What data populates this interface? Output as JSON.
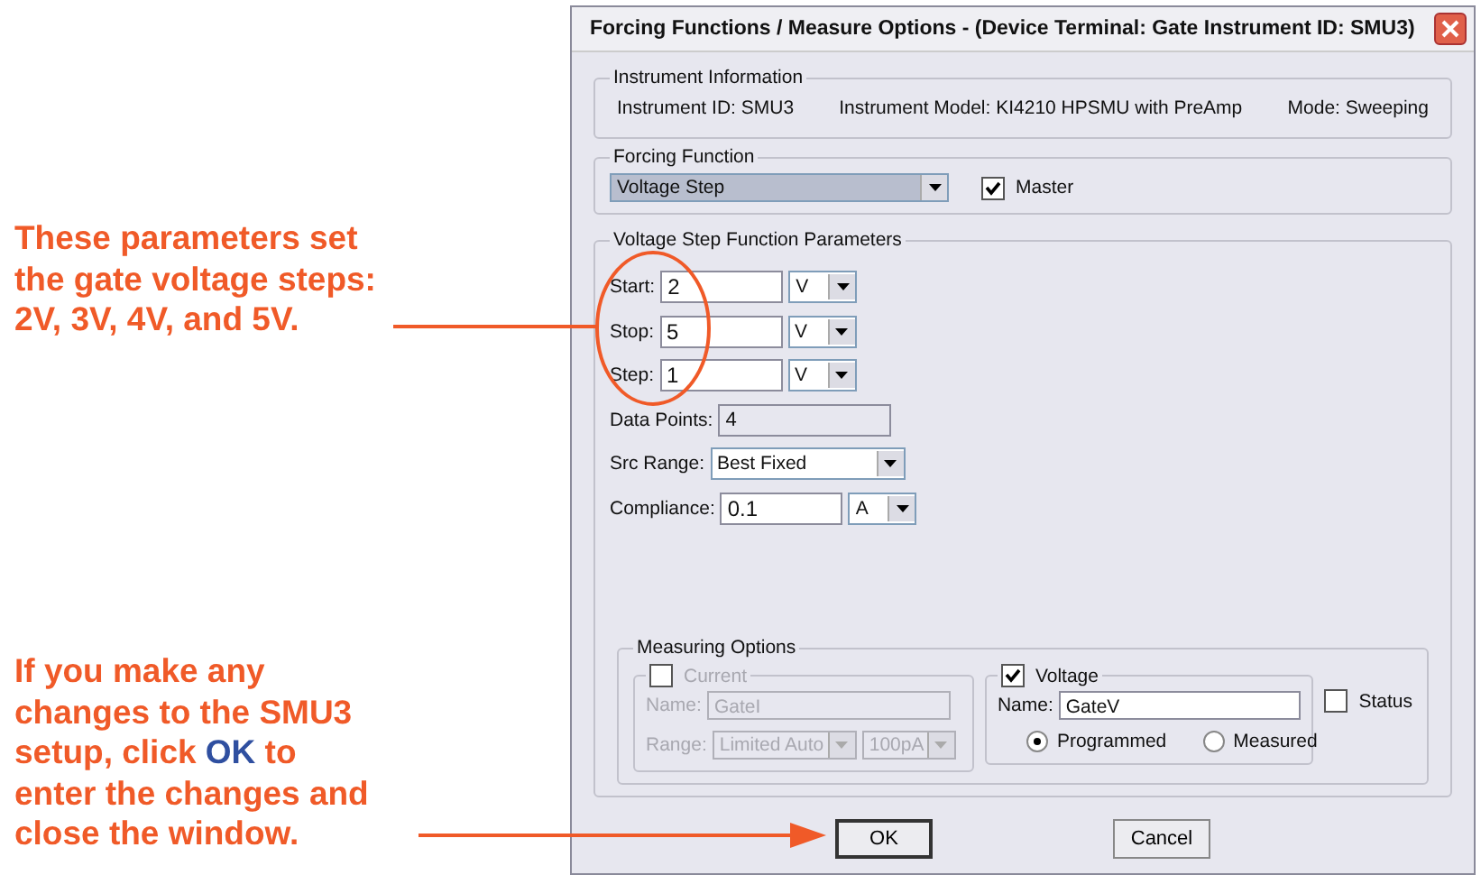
{
  "annotations": [
    {
      "lines": [
        [
          {
            "text": "These parameters set",
            "highlight": false
          }
        ],
        [
          {
            "text": "the gate voltage steps:",
            "highlight": false
          }
        ],
        [
          {
            "text": "2V, 3V, 4V, and 5V.",
            "highlight": false
          }
        ]
      ]
    },
    {
      "lines": [
        [
          {
            "text": "If you make any",
            "highlight": false
          }
        ],
        [
          {
            "text": "changes to the SMU3",
            "highlight": false
          }
        ],
        [
          {
            "text": "setup, click ",
            "highlight": false
          },
          {
            "text": "OK",
            "highlight": true
          },
          {
            "text": " to",
            "highlight": false
          }
        ],
        [
          {
            "text": "enter the changes and",
            "highlight": false
          }
        ],
        [
          {
            "text": "close the window.",
            "highlight": false
          }
        ]
      ]
    }
  ],
  "window": {
    "title": "Forcing Functions / Measure Options - (Device Terminal: Gate  Instrument ID: SMU3)"
  },
  "instrument_information": {
    "title": "Instrument Information",
    "instrument_id": "Instrument ID:  SMU3",
    "instrument_model": "Instrument Model:  KI4210 HPSMU with PreAmp",
    "mode": "Mode:  Sweeping"
  },
  "forcing_function": {
    "title": "Forcing Function",
    "value": "Voltage Step",
    "master": {
      "label": "Master",
      "checked": true
    }
  },
  "parameters": {
    "title": "Voltage Step Function Parameters",
    "rows": [
      {
        "kind": "unit",
        "label": "Start:",
        "value": "2",
        "unit": "V"
      },
      {
        "kind": "unit",
        "label": "Stop:",
        "value": "5",
        "unit": "V"
      },
      {
        "kind": "unit",
        "label": "Step:",
        "value": "1",
        "unit": "V"
      },
      {
        "kind": "readonly",
        "label": "Data Points:",
        "value": "4"
      },
      {
        "kind": "select",
        "label": "Src Range:",
        "value": "Best Fixed"
      },
      {
        "kind": "unit",
        "label": "Compliance:",
        "value": "0.1",
        "unit": "A"
      }
    ]
  },
  "measuring_options": {
    "title": "Measuring Options",
    "current": {
      "label": "Current",
      "checked": false,
      "disabled": true,
      "name_label": "Name:",
      "name": "GateI",
      "range_label": "Range:",
      "range": "Limited Auto",
      "range_value": "100pA"
    },
    "voltage": {
      "label": "Voltage",
      "checked": true,
      "name_label": "Name:",
      "name": "GateV",
      "options": [
        {
          "label": "Programmed",
          "selected": true
        },
        {
          "label": "Measured",
          "selected": false
        }
      ]
    },
    "status": {
      "label": "Status",
      "checked": false
    }
  },
  "buttons": [
    {
      "label": "OK",
      "default": true
    },
    {
      "label": "Cancel",
      "default": false
    }
  ]
}
